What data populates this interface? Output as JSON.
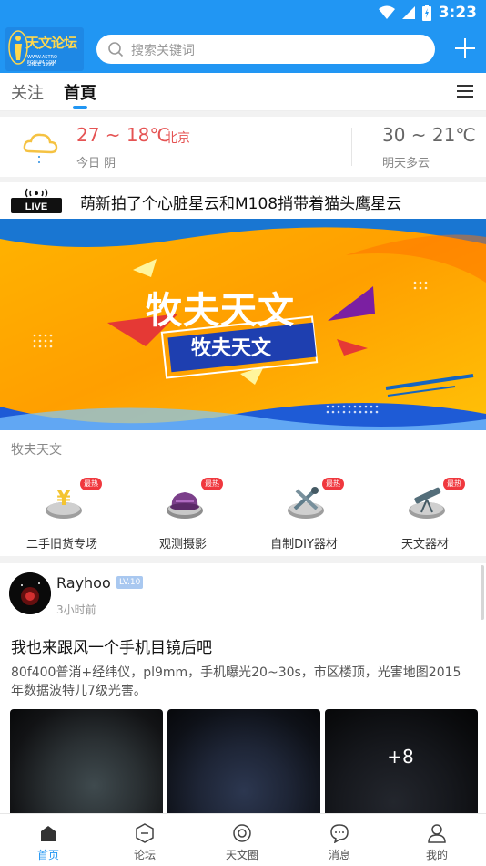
{
  "status_bar": {
    "time": "3:23"
  },
  "header": {
    "logo_text": "天文论坛",
    "logo_url_text": "WWW.ASTRO-FORUM.COM",
    "logo_since": "SINCE 1999",
    "search_placeholder": "搜索关键词"
  },
  "tabs": {
    "follow": "关注",
    "home": "首頁",
    "active": "home"
  },
  "weather": {
    "today_temp": "27 ~ 18℃",
    "city": "北京",
    "today_desc": "今日 阴",
    "tomorrow_temp": "30 ~ 21℃",
    "tomorrow_desc": "明天多云"
  },
  "live": {
    "badge": "LIVE",
    "headline": "萌新拍了个心脏星云和M108捎带着猫头鹰星云"
  },
  "banner": {
    "title": "牧夫天文",
    "subtitle": "牧夫天文"
  },
  "section": {
    "title": "牧夫天文"
  },
  "categories": [
    {
      "label": "二手旧货专场",
      "badge": "最热",
      "icon": "yen-disc-icon"
    },
    {
      "label": "观测摄影",
      "badge": "最热",
      "icon": "hat-icon"
    },
    {
      "label": "自制DIY器材",
      "badge": "最热",
      "icon": "tools-icon"
    },
    {
      "label": "天文器材",
      "badge": "最热",
      "icon": "telescope-icon"
    }
  ],
  "post": {
    "author": "Rayhoo",
    "level": "LV.10",
    "time": "3小时前",
    "title": "我也来跟风一个手机目镜后吧",
    "body": "80f400普消+经纬仪，pl9mm，手机曝光20~30s，市区楼顶，光害地图2015年数据波特儿7级光害。",
    "more_images": "+8"
  },
  "bottom_nav": [
    {
      "label": "首页",
      "icon": "home-icon",
      "active": true
    },
    {
      "label": "论坛",
      "icon": "forum-icon",
      "active": false
    },
    {
      "label": "天文圈",
      "icon": "circle-icon",
      "active": false
    },
    {
      "label": "消息",
      "icon": "message-icon",
      "active": false
    },
    {
      "label": "我的",
      "icon": "profile-icon",
      "active": false
    }
  ],
  "colors": {
    "primary": "#2196f3",
    "hot": "#f0383e",
    "warm_temp": "#e55353"
  }
}
